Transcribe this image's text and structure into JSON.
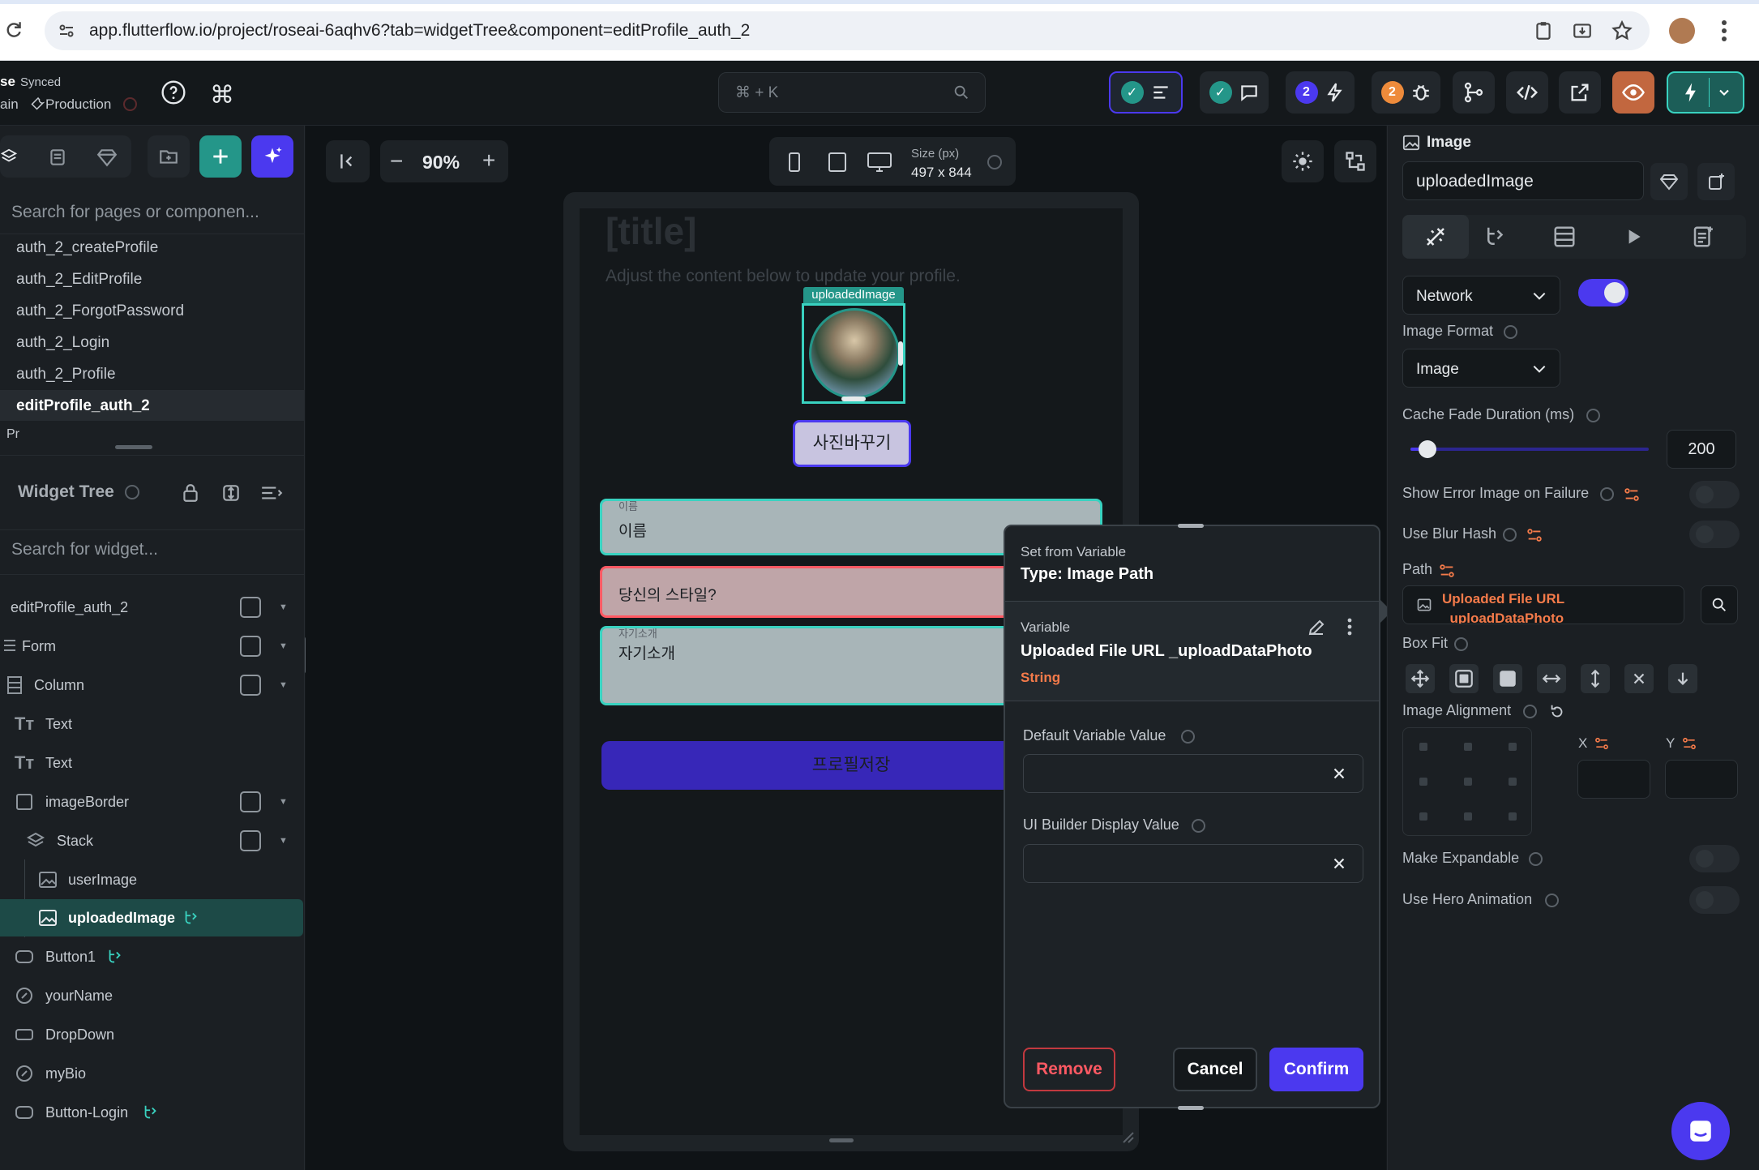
{
  "browser": {
    "url": "app.flutterflow.io/project/roseai-6aqhv6?tab=widgetTree&component=editProfile_auth_2"
  },
  "topbar": {
    "project_name_partial": "se",
    "sync_status": "Synced",
    "branch_partial": "ain",
    "environment": "Production",
    "search_shortcut": "⌘ + K",
    "badge_issues": "2",
    "badge_bugs": "2"
  },
  "left": {
    "search_pages_placeholder": "Search for pages or componen...",
    "pages": [
      "auth_2_createProfile",
      "auth_2_EditProfile",
      "auth_2_ForgotPassword",
      "auth_2_Login",
      "auth_2_Profile",
      "editProfile_auth_2",
      "Pr"
    ],
    "widget_tree_title": "Widget Tree",
    "search_widget_placeholder": "Search for widget...",
    "tree": [
      {
        "label": "editProfile_auth_2",
        "icon": "component-icon"
      },
      {
        "label": "Form",
        "icon": "form-icon"
      },
      {
        "label": "Column",
        "icon": "column-icon"
      },
      {
        "label": "Text",
        "icon": "text-icon"
      },
      {
        "label": "Text",
        "icon": "text-icon"
      },
      {
        "label": "imageBorder",
        "icon": "container-icon"
      },
      {
        "label": "Stack",
        "icon": "stack-icon"
      },
      {
        "label": "userImage",
        "icon": "image-icon"
      },
      {
        "label": "uploadedImage",
        "icon": "image-icon"
      },
      {
        "label": "Button1",
        "icon": "button-icon"
      },
      {
        "label": "yourName",
        "icon": "textfield-icon"
      },
      {
        "label": "DropDown",
        "icon": "dropdown-icon"
      },
      {
        "label": "myBio",
        "icon": "textfield-icon"
      },
      {
        "label": "Button-Login",
        "icon": "button-icon"
      }
    ]
  },
  "canvas": {
    "zoom": "90%",
    "size_label": "Size (px)",
    "size_value": "497 x 844",
    "title": "[title]",
    "subtitle": "Adjust the content below to update your profile.",
    "image_tag": "uploadedImage",
    "change_photo_button": "사진바꾸기",
    "name_float_label": "이름",
    "name_field": "이름",
    "style_field": "당신의 스타일?",
    "bio_float_label": "자기소개",
    "bio_field": "자기소개",
    "save_button": "프로필저장"
  },
  "popup": {
    "header_label": "Set from Variable",
    "header_type": "Type: Image Path",
    "variable_label": "Variable",
    "variable_name": "Uploaded File URL _uploadDataPhoto",
    "variable_type": "String",
    "default_value_label": "Default Variable Value",
    "default_value": "",
    "display_value_label": "UI Builder Display Value",
    "display_value": "",
    "remove_button": "Remove",
    "cancel_button": "Cancel",
    "confirm_button": "Confirm"
  },
  "right": {
    "widget_type": "Image",
    "widget_name": "uploadedImage",
    "source_select": "Network",
    "image_format_label": "Image Format",
    "image_format_value": "Image",
    "cache_fade_label": "Cache Fade Duration (ms)",
    "cache_fade_value": "200",
    "cache_fade_fraction": 0.07,
    "show_error_label": "Show Error Image on Failure",
    "blur_hash_label": "Use Blur Hash",
    "path_label": "Path",
    "path_value_line1": "Uploaded File URL",
    "path_value_line2": "_uploadDataPhoto",
    "box_fit_label": "Box Fit",
    "image_alignment_label": "Image Alignment",
    "x_label": "X",
    "y_label": "Y",
    "make_expandable_label": "Make Expandable",
    "hero_animation_label": "Use Hero Animation"
  },
  "colors": {
    "accent_purple": "#4b39ef",
    "accent_green": "#39d2c0",
    "error_red": "#ff5963",
    "path_orange": "#f57b4a"
  }
}
